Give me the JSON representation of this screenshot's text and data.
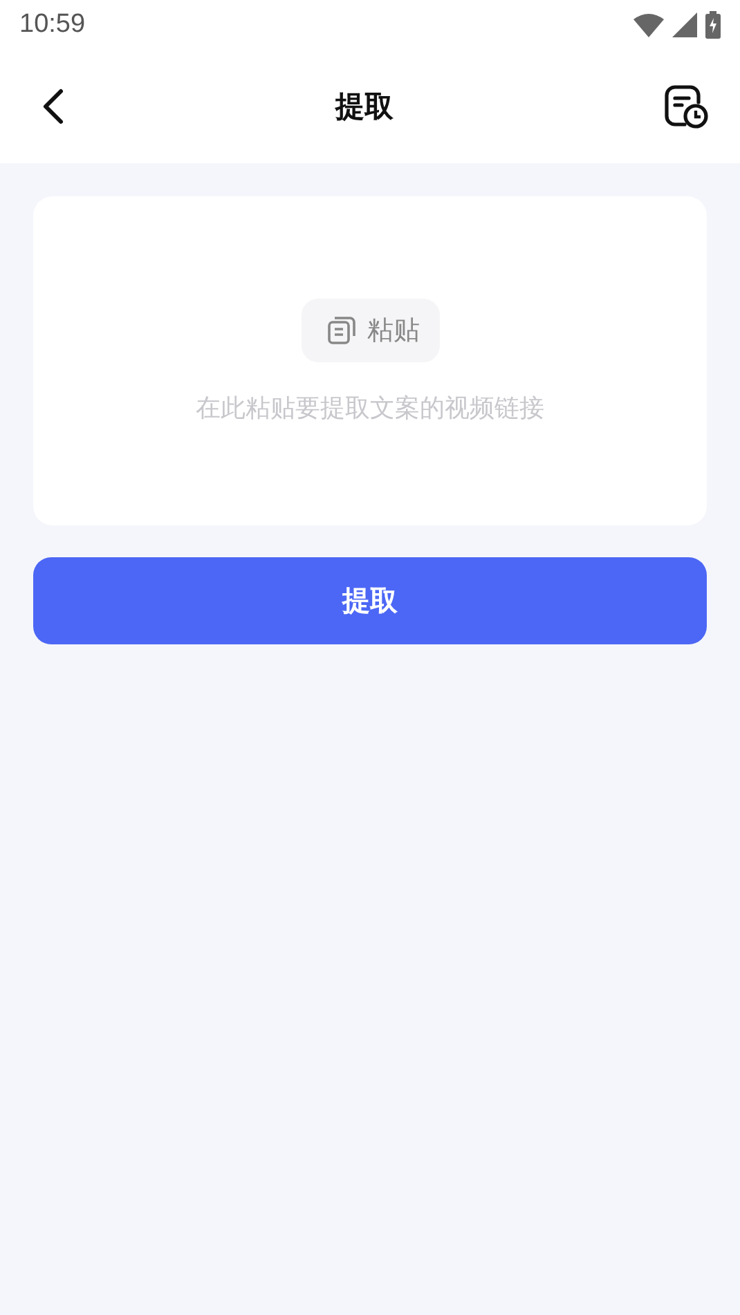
{
  "status_bar": {
    "time": "10:59"
  },
  "header": {
    "title": "提取"
  },
  "input_card": {
    "paste_button": "粘贴",
    "placeholder": "在此粘贴要提取文案的视频链接"
  },
  "submit_button": "提取"
}
